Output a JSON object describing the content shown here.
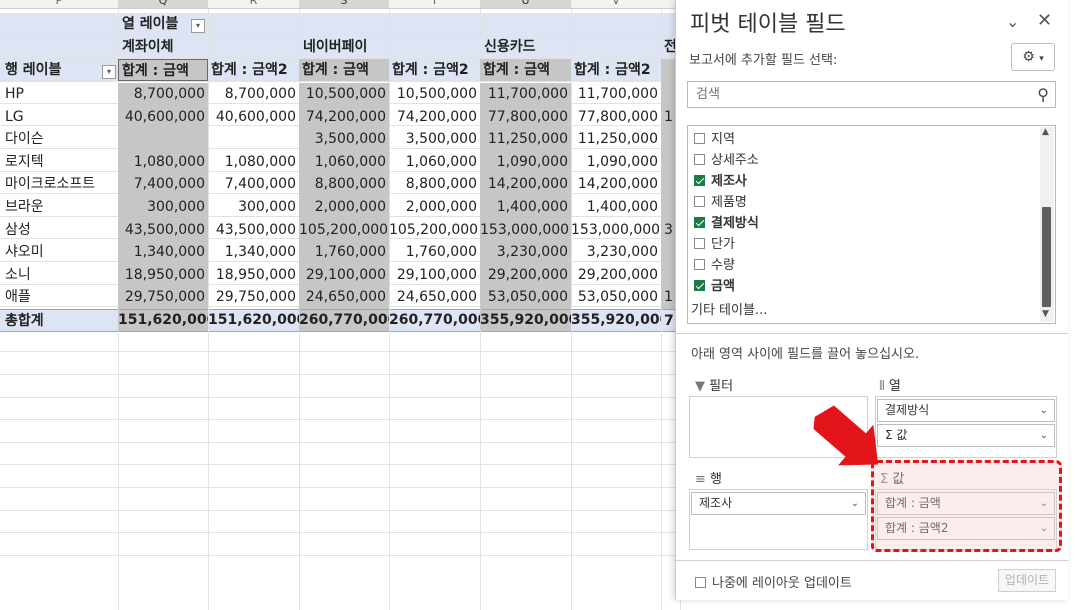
{
  "sheet": {
    "column_letters": [
      "P",
      "Q",
      "R",
      "S",
      "T",
      "U",
      "V",
      "",
      "A"
    ],
    "col_labels_caption": "열 레이블",
    "row_labels_caption": "행 레이블",
    "col_groups": [
      "계좌이체",
      "네이버페이",
      "신용카드",
      "전"
    ],
    "value_headers": [
      "합계 : 금액",
      "합계 : 금액2",
      "합계 : 금액",
      "합계 : 금액2",
      "합계 : 금액",
      "합계 : 금액2"
    ],
    "rows": [
      {
        "label": "HP",
        "values": [
          "8,700,000",
          "8,700,000",
          "10,500,000",
          "10,500,000",
          "11,700,000",
          "11,700,000"
        ]
      },
      {
        "label": "LG",
        "values": [
          "40,600,000",
          "40,600,000",
          "74,200,000",
          "74,200,000",
          "77,800,000",
          "77,800,000"
        ]
      },
      {
        "label": "다이슨",
        "values": [
          "",
          "",
          "3,500,000",
          "3,500,000",
          "11,250,000",
          "11,250,000"
        ]
      },
      {
        "label": "로지텍",
        "values": [
          "1,080,000",
          "1,080,000",
          "1,060,000",
          "1,060,000",
          "1,090,000",
          "1,090,000"
        ]
      },
      {
        "label": "마이크로소프트",
        "values": [
          "7,400,000",
          "7,400,000",
          "8,800,000",
          "8,800,000",
          "14,200,000",
          "14,200,000"
        ]
      },
      {
        "label": "브라운",
        "values": [
          "300,000",
          "300,000",
          "2,000,000",
          "2,000,000",
          "1,400,000",
          "1,400,000"
        ]
      },
      {
        "label": "삼성",
        "values": [
          "43,500,000",
          "43,500,000",
          "105,200,000",
          "105,200,000",
          "153,000,000",
          "153,000,000"
        ]
      },
      {
        "label": "샤오미",
        "values": [
          "1,340,000",
          "1,340,000",
          "1,760,000",
          "1,760,000",
          "3,230,000",
          "3,230,000"
        ]
      },
      {
        "label": "소니",
        "values": [
          "18,950,000",
          "18,950,000",
          "29,100,000",
          "29,100,000",
          "29,200,000",
          "29,200,000"
        ]
      },
      {
        "label": "애플",
        "values": [
          "29,750,000",
          "29,750,000",
          "24,650,000",
          "24,650,000",
          "53,050,000",
          "53,050,000"
        ]
      }
    ],
    "total": {
      "label": "총합계",
      "values": [
        "151,620,000",
        "151,620,000",
        "260,770,000",
        "260,770,000",
        "355,920,000",
        "355,920,000"
      ]
    },
    "clipped_right_digits": [
      "",
      "1",
      "",
      "",
      "",
      "",
      "3",
      "",
      "",
      "1",
      "7"
    ]
  },
  "pane": {
    "title": "피벗 테이블 필드",
    "collapse_icon": "chevron-down-icon",
    "close_icon": "close-icon",
    "choose_fields_label": "보고서에 추가할 필드 선택:",
    "gear_icon": "gear-icon",
    "search_placeholder": "검색",
    "fields": [
      {
        "label": "지역",
        "checked": false
      },
      {
        "label": "상세주소",
        "checked": false
      },
      {
        "label": "제조사",
        "checked": true
      },
      {
        "label": "제품명",
        "checked": false
      },
      {
        "label": "결제방식",
        "checked": true
      },
      {
        "label": "단가",
        "checked": false
      },
      {
        "label": "수량",
        "checked": false
      },
      {
        "label": "금액",
        "checked": true
      }
    ],
    "more_tables": "기타 테이블...",
    "drag_hint": "아래 영역 사이에 필드를 끌어 놓으십시오.",
    "areas": {
      "filter": {
        "title": "필터",
        "items": []
      },
      "columns": {
        "title": "열",
        "items": [
          "결제방식",
          "Σ 값"
        ]
      },
      "rows": {
        "title": "행",
        "items": [
          "제조사"
        ]
      },
      "values": {
        "title": "값",
        "items": [
          "합계 : 금액",
          "합계 : 금액2"
        ]
      }
    },
    "defer_update": "나중에 레이아웃 업데이트",
    "update_button": "업데이트",
    "highlight_color": "#e3141a"
  }
}
